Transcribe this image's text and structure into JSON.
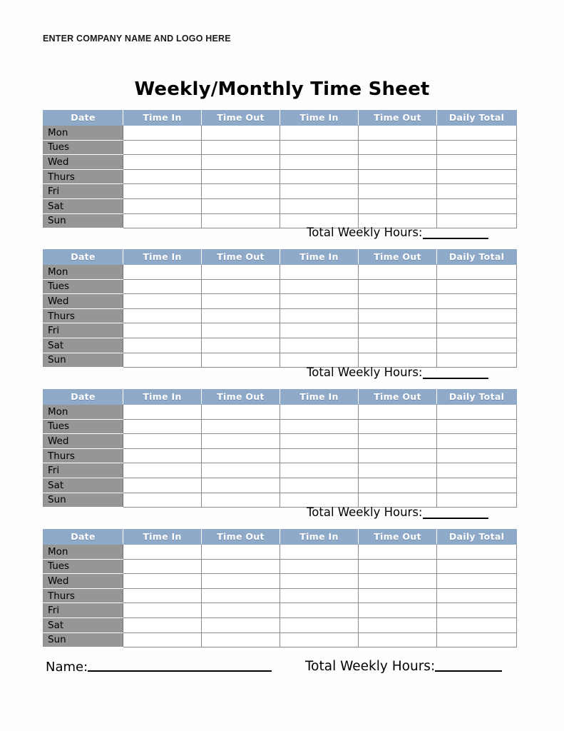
{
  "document": {
    "company_placeholder": "ENTER COMPANY NAME AND LOGO HERE",
    "title": "Weekly/Monthly Time Sheet"
  },
  "table": {
    "headers": [
      "Date",
      "Time In",
      "Time Out",
      "Time In",
      "Time Out",
      "Daily Total"
    ],
    "days": [
      "Mon",
      "Tues",
      "Wed",
      "Thurs",
      "Fri",
      "Sat",
      "Sun"
    ]
  },
  "weeks": [
    {
      "total_label": "Total Weekly Hours:",
      "total_value": ""
    },
    {
      "total_label": "Total Weekly Hours:",
      "total_value": ""
    },
    {
      "total_label": "Total Weekly Hours:",
      "total_value": ""
    },
    {
      "total_label": "Total Weekly Hours:",
      "total_value": ""
    }
  ],
  "footer": {
    "name_label": "Name:",
    "name_value": "",
    "total_label": "Total Weekly Hours:",
    "total_value": ""
  },
  "colors": {
    "header_blue": "#8fa9c9",
    "day_gray": "#969696",
    "border_gray": "#8a8a8a",
    "cell_white": "#ffffff",
    "text_black": "#000000"
  }
}
